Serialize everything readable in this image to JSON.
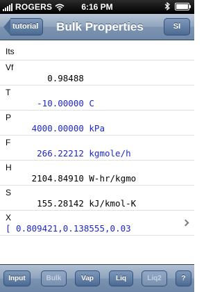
{
  "status_bar": {
    "carrier": "ROGERS",
    "time": "6:16 PM"
  },
  "nav": {
    "back_label": "tutorial",
    "title": "Bulk Properties",
    "units_label": "SI"
  },
  "list": {
    "header": "Its",
    "rows": [
      {
        "label": "Vf",
        "value": "        0.98488"
      },
      {
        "label": "T",
        "value": "      -10.00000 C"
      },
      {
        "label": "P",
        "value": "     4000.00000 kPa"
      },
      {
        "label": "F",
        "value": "      266.22212 kgmole/h"
      },
      {
        "label": "H",
        "value": "     2104.84910 W-hr/kgmo"
      },
      {
        "label": "S",
        "value": "      155.28142 kJ/kmol-K"
      },
      {
        "label": "X",
        "value": "[ 0.809421,0.138555,0.03"
      }
    ]
  },
  "toolbar": {
    "buttons": [
      {
        "label": "Input"
      },
      {
        "label": "Bulk"
      },
      {
        "label": "Vap"
      },
      {
        "label": "Liq"
      },
      {
        "label": "Liq2"
      },
      {
        "label": "?"
      }
    ]
  },
  "colors": {
    "editable_value": "#1c27c9",
    "readonly_value": "#000000",
    "nav_bar": "#7d94b1",
    "button": "#4c6a92"
  }
}
